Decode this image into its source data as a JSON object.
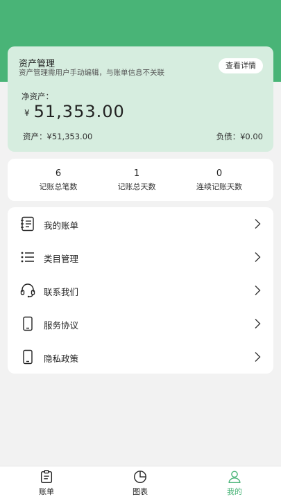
{
  "asset": {
    "title": "资产管理",
    "desc": "资产管理需用户手动编辑，与账单信息不关联",
    "detail_btn": "查看详情",
    "net_label": "净资产：",
    "currency": "¥",
    "net_value": "51,353.00",
    "assets_line": "资产：¥51,353.00",
    "debt_line": "负债：¥0.00"
  },
  "stats": [
    {
      "value": "6",
      "label": "记账总笔数"
    },
    {
      "value": "1",
      "label": "记账总天数"
    },
    {
      "value": "0",
      "label": "连续记账天数"
    }
  ],
  "menu": [
    {
      "label": "我的账单",
      "icon": "bill-list-icon"
    },
    {
      "label": "类目管理",
      "icon": "list-icon"
    },
    {
      "label": "联系我们",
      "icon": "headset-icon"
    },
    {
      "label": "服务协议",
      "icon": "phone-icon"
    },
    {
      "label": "隐私政策",
      "icon": "phone-icon"
    }
  ],
  "tabs": [
    {
      "label": "账单",
      "icon": "clipboard-icon"
    },
    {
      "label": "图表",
      "icon": "pie-chart-icon"
    },
    {
      "label": "我的",
      "icon": "user-icon"
    }
  ],
  "colors": {
    "accent": "#49b477",
    "card": "#d6eddf",
    "background": "#f2f2f2"
  }
}
